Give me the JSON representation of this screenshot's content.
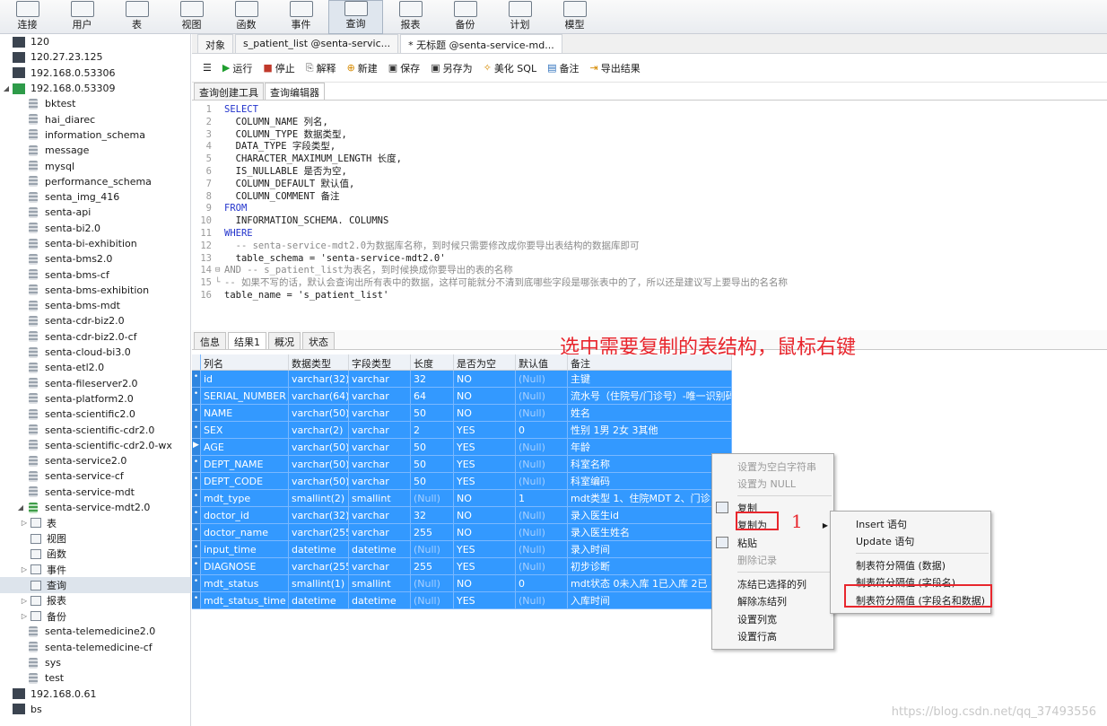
{
  "toolbar": {
    "buttons": [
      "连接",
      "用户",
      "表",
      "视图",
      "函数",
      "事件",
      "查询",
      "报表",
      "备份",
      "计划",
      "模型"
    ],
    "selected": "查询"
  },
  "sidebar": {
    "items": [
      {
        "label": "120",
        "type": "conn",
        "depth": 0
      },
      {
        "label": "120.27.23.125",
        "type": "conn",
        "depth": 0
      },
      {
        "label": "192.168.0.53306",
        "type": "conn",
        "depth": 0
      },
      {
        "label": "192.168.0.53309",
        "type": "conn-open",
        "depth": 0
      },
      {
        "label": "bktest",
        "type": "db",
        "depth": 1
      },
      {
        "label": "hai_diarec",
        "type": "db",
        "depth": 1
      },
      {
        "label": "information_schema",
        "type": "db",
        "depth": 1
      },
      {
        "label": "message",
        "type": "db",
        "depth": 1
      },
      {
        "label": "mysql",
        "type": "db",
        "depth": 1
      },
      {
        "label": "performance_schema",
        "type": "db",
        "depth": 1
      },
      {
        "label": "senta_img_416",
        "type": "db",
        "depth": 1
      },
      {
        "label": "senta-api",
        "type": "db",
        "depth": 1
      },
      {
        "label": "senta-bi2.0",
        "type": "db",
        "depth": 1
      },
      {
        "label": "senta-bi-exhibition",
        "type": "db",
        "depth": 1
      },
      {
        "label": "senta-bms2.0",
        "type": "db",
        "depth": 1
      },
      {
        "label": "senta-bms-cf",
        "type": "db",
        "depth": 1
      },
      {
        "label": "senta-bms-exhibition",
        "type": "db",
        "depth": 1
      },
      {
        "label": "senta-bms-mdt",
        "type": "db",
        "depth": 1
      },
      {
        "label": "senta-cdr-biz2.0",
        "type": "db",
        "depth": 1
      },
      {
        "label": "senta-cdr-biz2.0-cf",
        "type": "db",
        "depth": 1
      },
      {
        "label": "senta-cloud-bi3.0",
        "type": "db",
        "depth": 1
      },
      {
        "label": "senta-etl2.0",
        "type": "db",
        "depth": 1
      },
      {
        "label": "senta-fileserver2.0",
        "type": "db",
        "depth": 1
      },
      {
        "label": "senta-platform2.0",
        "type": "db",
        "depth": 1
      },
      {
        "label": "senta-scientific2.0",
        "type": "db",
        "depth": 1
      },
      {
        "label": "senta-scientific-cdr2.0",
        "type": "db",
        "depth": 1
      },
      {
        "label": "senta-scientific-cdr2.0-wx",
        "type": "db",
        "depth": 1
      },
      {
        "label": "senta-service2.0",
        "type": "db",
        "depth": 1
      },
      {
        "label": "senta-service-cf",
        "type": "db",
        "depth": 1
      },
      {
        "label": "senta-service-mdt",
        "type": "db",
        "depth": 1
      },
      {
        "label": "senta-service-mdt2.0",
        "type": "db-open",
        "depth": 1
      },
      {
        "label": "表",
        "type": "obj",
        "depth": 2
      },
      {
        "label": "视图",
        "type": "obj",
        "depth": 2
      },
      {
        "label": "函数",
        "type": "obj",
        "depth": 2
      },
      {
        "label": "事件",
        "type": "obj",
        "depth": 2
      },
      {
        "label": "查询",
        "type": "obj-sel",
        "depth": 2
      },
      {
        "label": "报表",
        "type": "obj",
        "depth": 2
      },
      {
        "label": "备份",
        "type": "obj",
        "depth": 2
      },
      {
        "label": "senta-telemedicine2.0",
        "type": "db",
        "depth": 1
      },
      {
        "label": "senta-telemedicine-cf",
        "type": "db",
        "depth": 1
      },
      {
        "label": "sys",
        "type": "db",
        "depth": 1
      },
      {
        "label": "test",
        "type": "db",
        "depth": 1
      },
      {
        "label": "192.168.0.61",
        "type": "conn",
        "depth": 0
      },
      {
        "label": "bs",
        "type": "conn",
        "depth": 0
      }
    ]
  },
  "object_tabs": [
    "对象",
    "s_patient_list @senta-servic...",
    "* 无标题 @senta-service-md..."
  ],
  "query_toolbar": {
    "buttons": [
      "运行",
      "停止",
      "解释",
      "新建",
      "保存",
      "另存为",
      "美化 SQL",
      "备注",
      "导出结果"
    ]
  },
  "query_tabs": [
    "查询创建工具",
    "查询编辑器"
  ],
  "editor": {
    "lines": [
      {
        "n": "1",
        "text": "SELECT",
        "style": "kw"
      },
      {
        "n": "2",
        "text": "  COLUMN_NAME 列名,",
        "style": ""
      },
      {
        "n": "3",
        "text": "  COLUMN_TYPE 数据类型,",
        "style": ""
      },
      {
        "n": "4",
        "text": "  DATA_TYPE 字段类型,",
        "style": ""
      },
      {
        "n": "5",
        "text": "  CHARACTER_MAXIMUM_LENGTH 长度,",
        "style": ""
      },
      {
        "n": "6",
        "text": "  IS_NULLABLE 是否为空,",
        "style": ""
      },
      {
        "n": "7",
        "text": "  COLUMN_DEFAULT 默认值,",
        "style": ""
      },
      {
        "n": "8",
        "text": "  COLUMN_COMMENT 备注",
        "style": ""
      },
      {
        "n": "9",
        "text": "FROM",
        "style": "kw"
      },
      {
        "n": "10",
        "text": "  INFORMATION_SCHEMA. COLUMNS",
        "style": ""
      },
      {
        "n": "11",
        "text": "WHERE",
        "style": "kw"
      },
      {
        "n": "12",
        "text": "  -- senta-service-mdt2.0为数据库名称，到时候只需要修改成你要导出表结构的数据库即可",
        "style": "cm"
      },
      {
        "n": "13",
        "text": "  table_schema = 'senta-service-mdt2.0'",
        "style": ""
      },
      {
        "n": "14",
        "text": "AND -- s_patient_list为表名，到时候换成你要导出的表的名称",
        "style": "cm"
      },
      {
        "n": "15",
        "text": "-- 如果不写的话，默认会查询出所有表中的数据，这样可能就分不清到底哪些字段是哪张表中的了，所以还是建议写上要导出的名名称",
        "style": "cm"
      },
      {
        "n": "16",
        "text": "table_name = 's_patient_list'",
        "style": ""
      }
    ]
  },
  "result_tabs": [
    "信息",
    "结果1",
    "概况",
    "状态"
  ],
  "annotation": "选中需要复制的表结构，鼠标右键",
  "grid": {
    "headers": [
      "列名",
      "数据类型",
      "字段类型",
      "长度",
      "是否为空",
      "默认值",
      "备注"
    ],
    "rows": [
      [
        "id",
        "varchar(32)",
        "varchar",
        "32",
        "NO",
        "(Null)",
        "主键"
      ],
      [
        "SERIAL_NUMBER",
        "varchar(64)",
        "varchar",
        "64",
        "NO",
        "(Null)",
        "流水号（住院号/门诊号）-唯一识别码"
      ],
      [
        "NAME",
        "varchar(50)",
        "varchar",
        "50",
        "NO",
        "(Null)",
        "姓名"
      ],
      [
        "SEX",
        "varchar(2)",
        "varchar",
        "2",
        "YES",
        "0",
        "性别  1男  2女  3其他"
      ],
      [
        "AGE",
        "varchar(50)",
        "varchar",
        "50",
        "YES",
        "(Null)",
        "年龄"
      ],
      [
        "DEPT_NAME",
        "varchar(50)",
        "varchar",
        "50",
        "YES",
        "(Null)",
        "科室名称"
      ],
      [
        "DEPT_CODE",
        "varchar(50)",
        "varchar",
        "50",
        "YES",
        "(Null)",
        "科室编码"
      ],
      [
        "mdt_type",
        "smallint(2)",
        "smallint",
        "(Null)",
        "NO",
        "1",
        "mdt类型  1、住院MDT  2、门诊"
      ],
      [
        "doctor_id",
        "varchar(32)",
        "varchar",
        "32",
        "NO",
        "(Null)",
        "录入医生id"
      ],
      [
        "doctor_name",
        "varchar(255)",
        "varchar",
        "255",
        "NO",
        "(Null)",
        "录入医生姓名"
      ],
      [
        "input_time",
        "datetime",
        "datetime",
        "(Null)",
        "YES",
        "(Null)",
        "录入时间"
      ],
      [
        "DIAGNOSE",
        "varchar(255)",
        "varchar",
        "255",
        "YES",
        "(Null)",
        "初步诊断"
      ],
      [
        "mdt_status",
        "smallint(1)",
        "smallint",
        "(Null)",
        "NO",
        "0",
        "mdt状态  0未入库  1已入库  2已"
      ],
      [
        "mdt_status_time",
        "datetime",
        "datetime",
        "(Null)",
        "YES",
        "(Null)",
        "入库时间"
      ]
    ]
  },
  "context_menu": {
    "items": [
      {
        "label": "设置为空白字符串",
        "disabled": true
      },
      {
        "label": "设置为 NULL",
        "disabled": true
      },
      {
        "sep": true
      },
      {
        "label": "复制",
        "icon": "copy-icon"
      },
      {
        "label": "复制为",
        "submenu": true,
        "highlight": true
      },
      {
        "label": "粘贴",
        "icon": "paste-icon"
      },
      {
        "label": "删除记录",
        "disabled": true
      },
      {
        "sep": true
      },
      {
        "label": "冻结已选择的列"
      },
      {
        "label": "解除冻结列"
      },
      {
        "label": "设置列宽"
      },
      {
        "label": "设置行高"
      }
    ],
    "marker": "1"
  },
  "submenu": {
    "items": [
      {
        "label": "Insert 语句"
      },
      {
        "label": "Update 语句"
      },
      {
        "sep": true
      },
      {
        "label": "制表符分隔值 (数据)"
      },
      {
        "label": "制表符分隔值 (字段名)"
      },
      {
        "label": "制表符分隔值 (字段名和数据)",
        "highlight": true
      }
    ]
  },
  "watermark": "https://blog.csdn.net/qq_37493556"
}
